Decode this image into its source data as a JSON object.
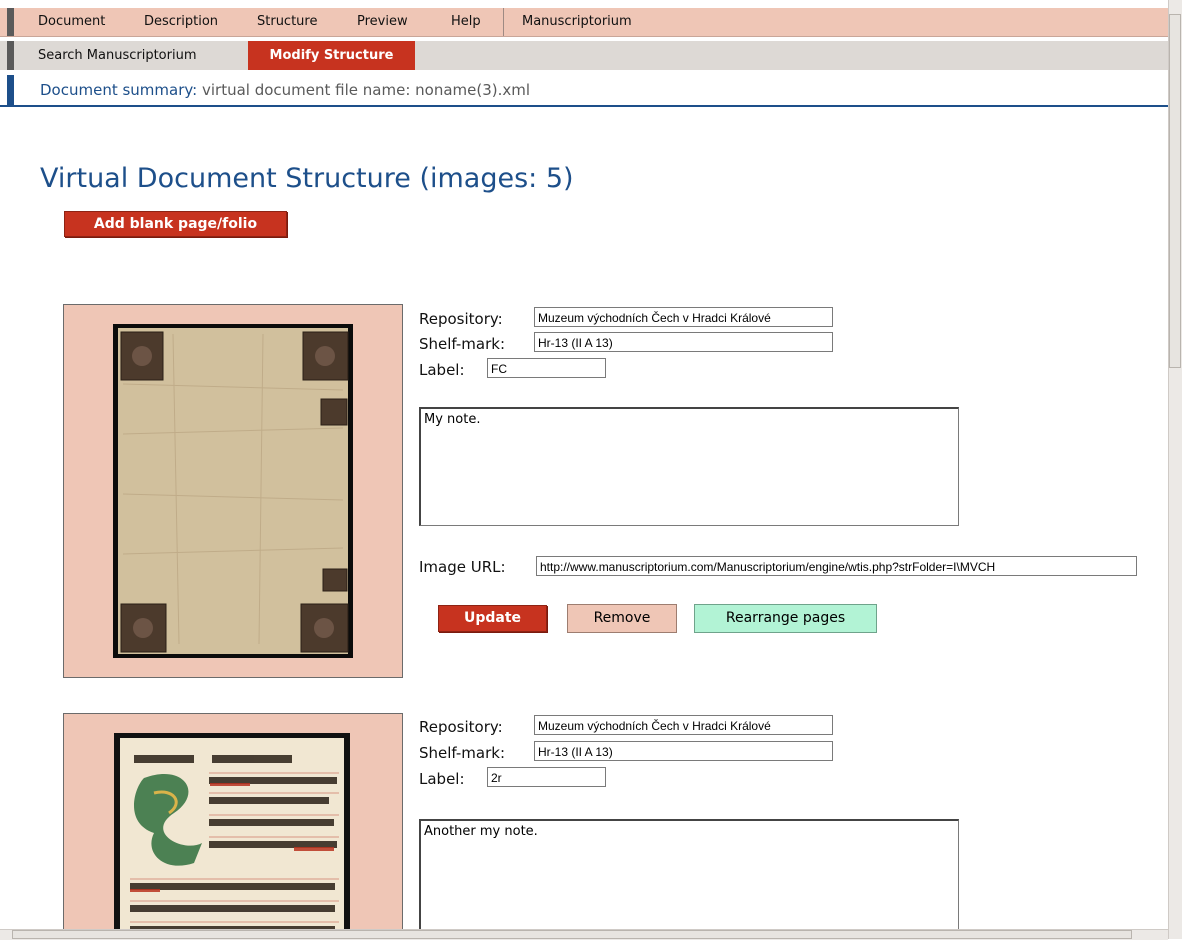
{
  "menu": {
    "items": [
      "Document",
      "Description",
      "Structure",
      "Preview",
      "Help",
      "Manuscriptorium"
    ]
  },
  "submenu": {
    "search_label": "Search Manuscriptorium",
    "modify_label": "Modify Structure"
  },
  "summary": {
    "label": "Document summary:",
    "text": " virtual document file name: noname(3).xml"
  },
  "heading": "Virtual Document Structure (images: 5)",
  "add_blank_label": "Add blank page/folio",
  "field_labels": {
    "repository": "Repository:",
    "shelfmark": "Shelf-mark:",
    "label": "Label:",
    "image_url": "Image URL:"
  },
  "pages": [
    {
      "repository": "Muzeum východních Čech v Hradci Králové",
      "shelfmark": "Hr-13 (II A 13)",
      "label": "FC",
      "note": "My note.",
      "image_url": "http://www.manuscriptorium.com/Manuscriptorium/engine/wtis.php?strFolder=I\\MVCH",
      "image_kind": "book-cover-thumbnail"
    },
    {
      "repository": "Muzeum východních Čech v Hradci Králové",
      "shelfmark": "Hr-13 (II A 13)",
      "label": "2r",
      "note": "Another my note.",
      "image_kind": "manuscript-page-thumbnail"
    }
  ],
  "buttons": {
    "update": "Update",
    "remove": "Remove",
    "rearrange": "Rearrange pages"
  },
  "colors": {
    "accent_red": "#c7331f",
    "menu_pink": "#efc6b6",
    "title_blue": "#1d4f8a",
    "mint": "#b2f3d5"
  }
}
